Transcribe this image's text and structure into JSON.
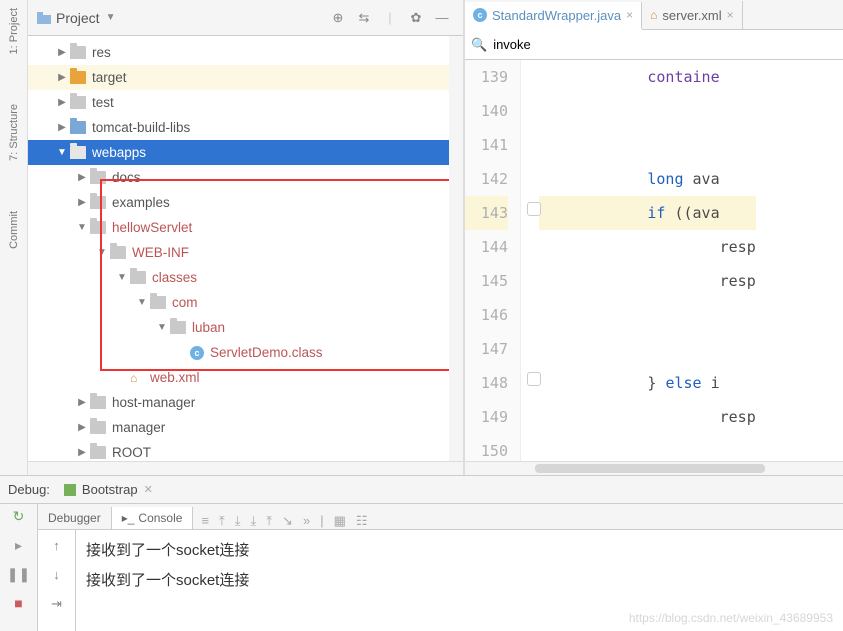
{
  "left_rail": {
    "project": "1: Project",
    "structure": "7: Structure",
    "commit": "Commit"
  },
  "tree_header": {
    "label": "Project"
  },
  "tree": [
    {
      "ind": 1,
      "arrow": "▶",
      "folder": "gray",
      "label": "res"
    },
    {
      "ind": 1,
      "arrow": "▶",
      "folder": "orange",
      "label": "target",
      "row": "y"
    },
    {
      "ind": 1,
      "arrow": "▶",
      "folder": "gray",
      "label": "test",
      "badge": true
    },
    {
      "ind": 1,
      "arrow": "▶",
      "folder": "blue",
      "label": "tomcat-build-libs"
    },
    {
      "ind": 1,
      "arrow": "▼",
      "folder": "blue",
      "label": "webapps",
      "row": "sel"
    },
    {
      "ind": 2,
      "arrow": "▶",
      "folder": "gray",
      "label": "docs"
    },
    {
      "ind": 2,
      "arrow": "▶",
      "folder": "gray",
      "label": "examples"
    },
    {
      "ind": 2,
      "arrow": "▼",
      "folder": "gray",
      "label": "hellowServlet",
      "red": true
    },
    {
      "ind": 3,
      "arrow": "▼",
      "folder": "gray",
      "label": "WEB-INF",
      "red": true
    },
    {
      "ind": 4,
      "arrow": "▼",
      "folder": "gray",
      "label": "classes",
      "red": true
    },
    {
      "ind": 5,
      "arrow": "▼",
      "folder": "gray",
      "label": "com",
      "red": true
    },
    {
      "ind": 6,
      "arrow": "▼",
      "folder": "gray",
      "label": "luban",
      "red": true
    },
    {
      "ind": 7,
      "arrow": "",
      "folder": "class",
      "label": "ServletDemo.class",
      "red": true
    },
    {
      "ind": 4,
      "arrow": "",
      "folder": "xml",
      "label": "web.xml",
      "red": true
    },
    {
      "ind": 2,
      "arrow": "▶",
      "folder": "gray",
      "label": "host-manager"
    },
    {
      "ind": 2,
      "arrow": "▶",
      "folder": "gray",
      "label": "manager"
    },
    {
      "ind": 2,
      "arrow": "▶",
      "folder": "gray",
      "label": "ROOT"
    }
  ],
  "editor": {
    "tabs": [
      {
        "icon": "c",
        "label": "StandardWrapper.java",
        "active": true
      },
      {
        "icon": "x",
        "label": "server.xml",
        "active": false
      }
    ],
    "search_value": "invoke",
    "gutter": [
      "139",
      "140",
      "141",
      "142",
      "143",
      "144",
      "145",
      "146",
      "147",
      "148",
      "149",
      "150"
    ],
    "lines": [
      {
        "txt": "containe",
        "cls": "purple",
        "ind": 6
      },
      {
        "txt": "",
        "ind": 0
      },
      {
        "txt": "",
        "ind": 0
      },
      {
        "txt": "long ava",
        "kw": "long",
        "rest": " ava",
        "ind": 6
      },
      {
        "txt": "if ((ava",
        "kw": "if",
        "rest": " ((ava",
        "ind": 6,
        "hl": true
      },
      {
        "txt": "resp",
        "ind": 10
      },
      {
        "txt": "resp",
        "ind": 10
      },
      {
        "txt": "",
        "ind": 0
      },
      {
        "txt": "",
        "ind": 0
      },
      {
        "txt": "} else i",
        "kw": "else",
        "pre": "} ",
        "rest": " i",
        "ind": 6
      },
      {
        "txt": "resp",
        "ind": 10
      },
      {
        "txt": "",
        "ind": 0
      }
    ]
  },
  "debug": {
    "label": "Debug:",
    "config": "Bootstrap",
    "tabs": [
      {
        "label": "Debugger"
      },
      {
        "label": "Console",
        "active": true
      }
    ],
    "console": [
      "接收到了一个socket连接",
      "接收到了一个socket连接"
    ],
    "watermark": "https://blog.csdn.net/weixin_43689953"
  }
}
